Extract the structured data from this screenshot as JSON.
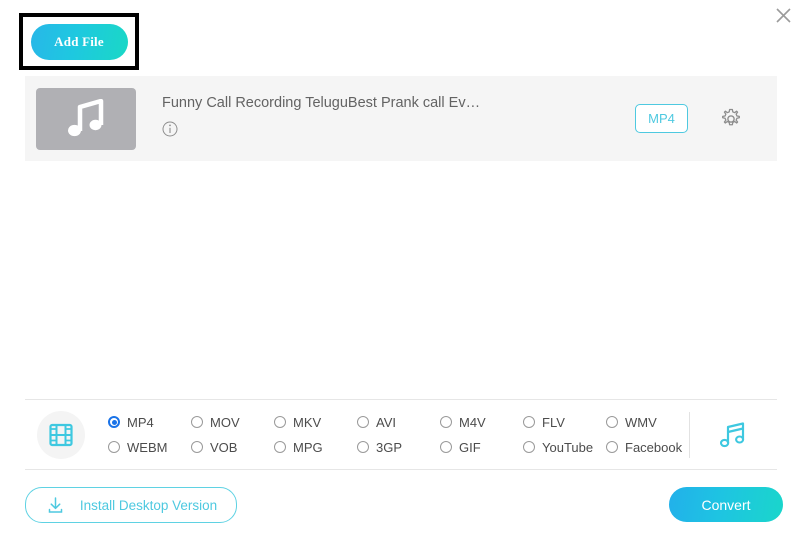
{
  "window": {
    "close_label": "×",
    "close_icon": "close-icon"
  },
  "toolbar": {
    "add_file_label": "Add File"
  },
  "file": {
    "title": "Funny Call Recording TeluguBest Prank call Ev…",
    "thumb_icon": "music-note-icon",
    "info_icon": "info-icon",
    "format_badge": "MP4",
    "settings_icon": "gear-icon"
  },
  "format_bar": {
    "video_icon": "film-strip-icon",
    "audio_icon": "music-note-icon",
    "selected": "MP4",
    "options": [
      {
        "label": "MP4",
        "selected": true
      },
      {
        "label": "MOV",
        "selected": false
      },
      {
        "label": "MKV",
        "selected": false
      },
      {
        "label": "AVI",
        "selected": false
      },
      {
        "label": "M4V",
        "selected": false
      },
      {
        "label": "FLV",
        "selected": false
      },
      {
        "label": "WMV",
        "selected": false
      },
      {
        "label": "WEBM",
        "selected": false
      },
      {
        "label": "VOB",
        "selected": false
      },
      {
        "label": "MPG",
        "selected": false
      },
      {
        "label": "3GP",
        "selected": false
      },
      {
        "label": "GIF",
        "selected": false
      },
      {
        "label": "YouTube",
        "selected": false
      },
      {
        "label": "Facebook",
        "selected": false
      }
    ]
  },
  "footer": {
    "install_label": "Install Desktop Version",
    "install_icon": "download-icon",
    "convert_label": "Convert"
  },
  "colors": {
    "accent_start": "#22b0ea",
    "accent_end": "#1ad6cb",
    "cyan": "#4ec9e0",
    "radio_selected": "#1a73e8",
    "row_bg": "#f5f5f5",
    "thumb_bg": "#b0b0b4"
  }
}
